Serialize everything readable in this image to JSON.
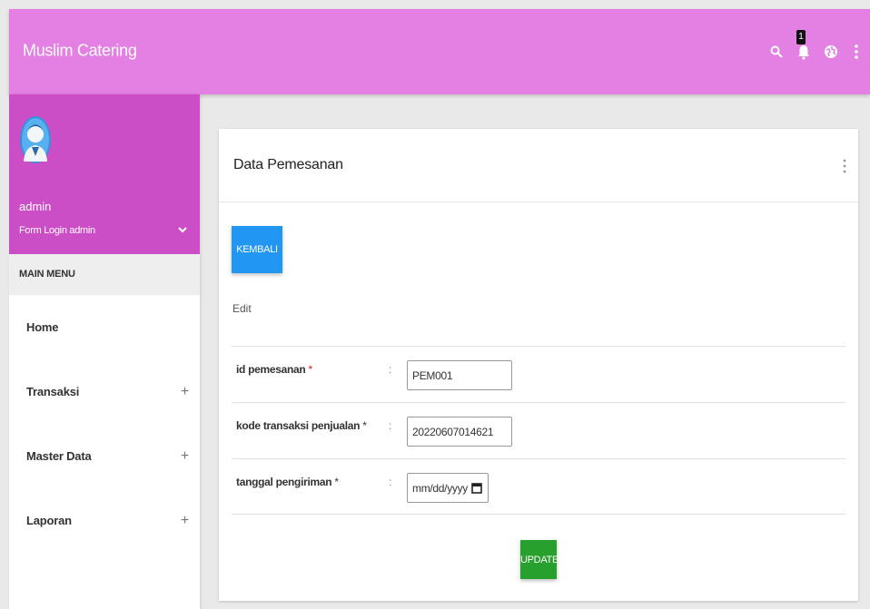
{
  "navbar": {
    "brand": "Muslim Catering",
    "notification_count": "1",
    "icons": [
      "search-icon",
      "bell-icon",
      "globe-icon",
      "more-vert-icon"
    ],
    "color": "#e47fe3"
  },
  "sidebar": {
    "user": {
      "name": "admin",
      "subtitle": "Form Login admin",
      "avatar_icon": "user-avatar-icon",
      "color": "#cc4ec6"
    },
    "menu_header": "MAIN MENU",
    "items": [
      {
        "label": "Home",
        "expandable": false
      },
      {
        "label": "Transaksi",
        "expandable": true,
        "expand_symbol": "+"
      },
      {
        "label": "Master Data",
        "expandable": true,
        "expand_symbol": "+"
      },
      {
        "label": "Laporan",
        "expandable": true,
        "expand_symbol": "+"
      }
    ]
  },
  "card": {
    "title": "Data Pemesanan",
    "back_button": "KEMBALI",
    "section_label": "Edit",
    "fields": [
      {
        "label": "id pemesanan",
        "required_mark": "*",
        "colon": ":",
        "value": "PEM001"
      },
      {
        "label": "kode transaksi penjualan",
        "required_mark": "*",
        "colon": ":",
        "value": "20220607014621"
      },
      {
        "label": "tanggal pengiriman",
        "required_mark": "*",
        "colon": ":",
        "value": "mm/dd/yyyy"
      }
    ],
    "update_button": "UPDATE"
  },
  "colors": {
    "primary_button": "#2196f3",
    "update_button": "#28a02d",
    "required": "#e0161f"
  }
}
